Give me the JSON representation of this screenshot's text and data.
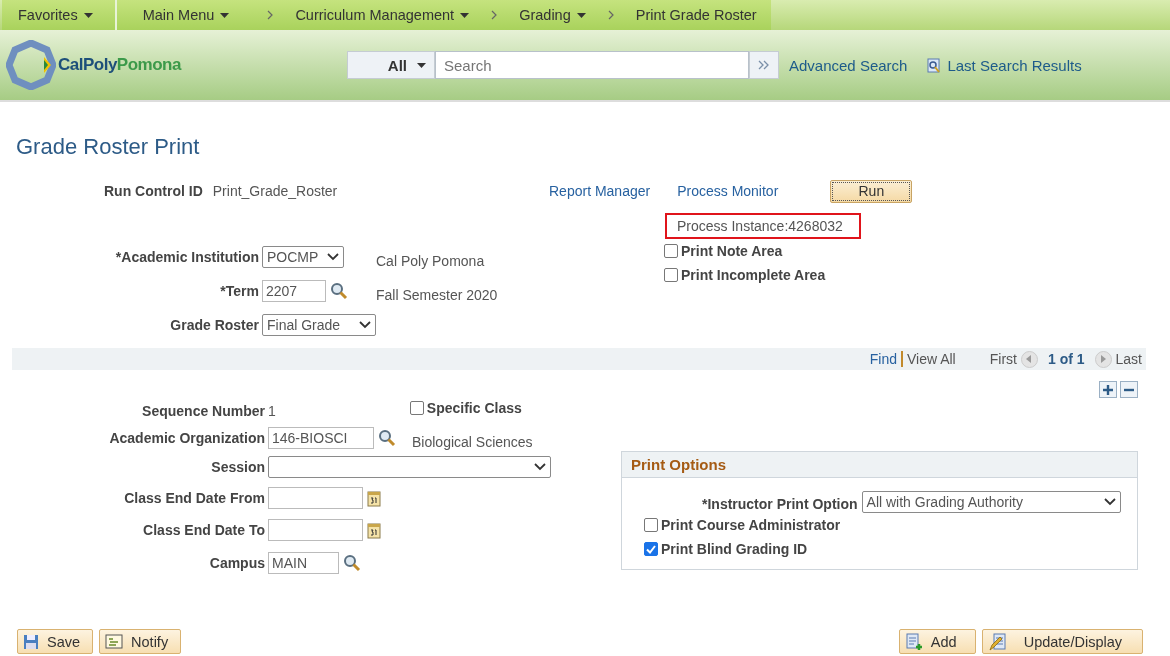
{
  "nav": [
    {
      "label": "Favorites",
      "dropdown": true
    },
    {
      "label": "Main Menu",
      "dropdown": true
    },
    {
      "label": "Curriculum Management",
      "dropdown": true
    },
    {
      "label": "Grading",
      "dropdown": true
    },
    {
      "label": "Print Grade Roster",
      "dropdown": false
    }
  ],
  "header": {
    "logo_1": "CalPoly",
    "logo_2": "Pomona",
    "search_scope": "All",
    "search": {
      "placeholder": "Search"
    },
    "links": [
      "Advanced Search",
      "Last Search Results"
    ]
  },
  "title": "Grade Roster Print",
  "run_control": {
    "label": "Run Control ID",
    "value": "Print_Grade_Roster"
  },
  "process_links": [
    "Report Manager",
    "Process Monitor"
  ],
  "run_button": "Run",
  "process_instance": "Process Instance:4268032",
  "fields_top": [
    {
      "kind": "select",
      "label": "*Academic Institution",
      "value": "POCMP",
      "description": "Cal Poly Pomona"
    },
    {
      "kind": "lookup",
      "label": "*Term",
      "value": "2207",
      "description": "Fall Semester 2020"
    },
    {
      "kind": "select",
      "label": "Grade Roster",
      "value": "Final Grade"
    }
  ],
  "checks_top": [
    {
      "label": "Print Note Area",
      "checked": false
    },
    {
      "label": "Print Incomplete Area",
      "checked": false
    }
  ],
  "navbar": {
    "find": "Find",
    "view_all": "View All",
    "first": "First",
    "count": "1 of 1",
    "last": "Last"
  },
  "fields": [
    {
      "kind": "text",
      "label": "Sequence Number",
      "value": "1"
    },
    {
      "kind": "lookup",
      "label": "Academic Organization",
      "value": "146-BIOSCI",
      "description": "Biological Sciences"
    },
    {
      "kind": "select",
      "label": "Session"
    },
    {
      "kind": "date",
      "label": "Class End Date From"
    },
    {
      "kind": "date",
      "label": "Class End Date To"
    },
    {
      "kind": "lookup",
      "label": "Campus",
      "value": "MAIN"
    }
  ],
  "specific_class": {
    "label": "Specific Class",
    "checked": false
  },
  "print_options": {
    "title": "Print Options",
    "instructor_option": {
      "label": "*Instructor Print Option",
      "value": "All with Grading Authority"
    },
    "checks": [
      {
        "label": "Print Course Administrator",
        "checked": false
      },
      {
        "label": "Print Blind Grading ID",
        "checked": true
      }
    ]
  },
  "buttons_left": [
    {
      "kind": "save",
      "label": "Save"
    },
    {
      "kind": "notify",
      "label": "Notify"
    }
  ],
  "buttons_right": [
    {
      "kind": "add",
      "label": "Add"
    },
    {
      "kind": "update",
      "label": "Update/Display"
    }
  ]
}
